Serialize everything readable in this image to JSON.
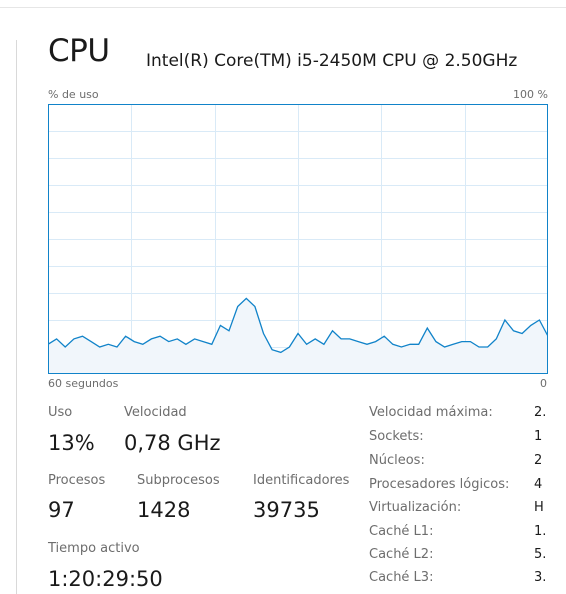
{
  "header": {
    "title": "CPU",
    "cpu_model": "Intel(R) Core(TM) i5-2450M CPU @ 2.50GHz"
  },
  "graph": {
    "y_label": "% de uso",
    "y_max_label": "100 %",
    "x_left_label": "60 segundos",
    "x_right_label": "0"
  },
  "chart_data": {
    "type": "area",
    "title": "",
    "xlabel": "60 segundos",
    "ylabel": "% de uso",
    "xlim": [
      60,
      0
    ],
    "ylim": [
      0,
      100
    ],
    "grid": true,
    "series": [
      {
        "values": [
          11,
          13,
          10,
          13,
          14,
          12,
          10,
          11,
          10,
          14,
          12,
          11,
          13,
          14,
          12,
          13,
          11,
          13,
          12,
          11,
          18,
          16,
          25,
          28,
          25,
          15,
          9,
          8,
          10,
          15,
          11,
          13,
          11,
          16,
          13,
          13,
          12,
          11,
          12,
          14,
          11,
          10,
          11,
          11,
          17,
          12,
          10,
          11,
          12,
          12,
          10,
          10,
          13,
          20,
          16,
          15,
          18,
          20,
          14
        ]
      }
    ]
  },
  "stats": {
    "uso_label": "Uso",
    "uso_value": "13%",
    "velocidad_label": "Velocidad",
    "velocidad_value": "0,78 GHz",
    "procesos_label": "Procesos",
    "procesos_value": "97",
    "subprocesos_label": "Subprocesos",
    "subprocesos_value": "1428",
    "identificadores_label": "Identificadores",
    "identificadores_value": "39735",
    "tiempo_label": "Tiempo activo",
    "tiempo_value": "1:20:29:50"
  },
  "info": [
    {
      "key": "Velocidad máxima:",
      "value": "2."
    },
    {
      "key": "Sockets:",
      "value": "1"
    },
    {
      "key": "Núcleos:",
      "value": "2"
    },
    {
      "key": "Procesadores lógicos:",
      "value": "4"
    },
    {
      "key": "Virtualización:",
      "value": "H"
    },
    {
      "key": "Caché L1:",
      "value": "1."
    },
    {
      "key": "Caché L2:",
      "value": "5."
    },
    {
      "key": "Caché L3:",
      "value": "3."
    }
  ],
  "colors": {
    "accent": "#1183c9",
    "gridline": "#d9eaf7",
    "fill": "#f1f6fb"
  }
}
